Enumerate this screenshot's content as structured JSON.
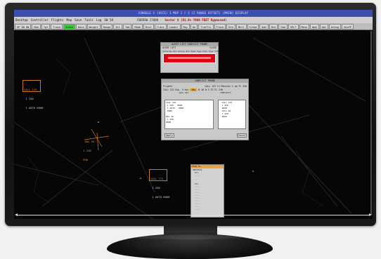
{
  "window": {
    "title": "CONSOLE 1 (VSCS) 1 MAP 1 / 3 (2 RANGE OFFSET)  (MAIN) DISPLAY"
  },
  "menubar": {
    "items": [
      "Desktop",
      "Controller",
      "Flights",
      "Map",
      "Save",
      "Tools",
      "Log"
    ],
    "zone": "SW 58",
    "center_text": "CWSDSW 17000 -",
    "warning_text": "Sector 8 (81.8% 7000 FEET Bypassed)"
  },
  "toolbar": {
    "buttons": [
      "UP DN DN",
      "Map",
      "Tgt",
      "Track",
      "Scale",
      "Data",
      "Weight",
      "Range",
      "Alt",
      "Tab",
      "Mode",
      "Dist",
      "Trans",
      "Leader",
      "Rwy",
      "Wx",
      "Traffic",
      "Track",
      "Brk",
      "Mtcl",
      "Sched",
      "Adv",
      "Rte",
      "Cmd",
      "SPLT",
      "Menu",
      "WpQ",
      "Opt",
      "Wrkng",
      "ShwFP"
    ],
    "active_index": 4,
    "accent": "#2bd62b"
  },
  "targets": [
    {
      "lines": [
        "CALL 123",
        " 1 250",
        " 1 A070 0000"
      ],
      "color": "orange"
    },
    {
      "lines": [
        "  DAL 44",
        " 1 240",
        " B90"
      ],
      "color": "orange"
    },
    {
      "lines": [
        "CALL 772",
        " 1 250",
        " 1 A070 0000"
      ],
      "color": "orange"
    }
  ],
  "alert_dialog": {
    "title": "ALERT LIST  CONFLICT PROBE",
    "subtitle": "ALERT LIST",
    "close": "CLOSE",
    "columns": "Callsign  Alt  Action  Brk  Head  Type  Fpln  Type  Tnfloc",
    "accent": "#e00010"
  },
  "conflict_dialog": {
    "title": "CONFLICT PROBE",
    "row1_left": "Flights",
    "row1_right": "CALL 123   12 Minutes  1 nm  FL 250",
    "row2_left": "CALL 123  Exp. 5 min",
    "row2_chip": "30s",
    "row2_right": "N 40   W 5 ST  FL 240",
    "left_header": "CALL 123",
    "right_header": "CONFLICTS",
    "tbl_left": [
      "CALL 123   ",
      " 1 250   0000",
      " 1 A070   0000",
      " 0000",
      "  ",
      "DAL 44",
      " 1 250   ",
      "0000"
    ],
    "tbl_right": [
      "  CALL 123",
      "  1 250",
      "  0000",
      "  CALL 44",
      "  1 240",
      "  0000"
    ],
    "btn_left": "Apply",
    "btn_right": "Cancel"
  },
  "side_panel": {
    "header": "PTRO  P1",
    "lines": [
      "PREVIOUS",
      "  PTL",
      "  ----",
      " ",
      " ",
      "  PTL",
      "  ----",
      "  ----",
      "  ----",
      "  ----",
      "  ----",
      "  ----",
      "  ----",
      "  ----",
      "  ----"
    ]
  }
}
